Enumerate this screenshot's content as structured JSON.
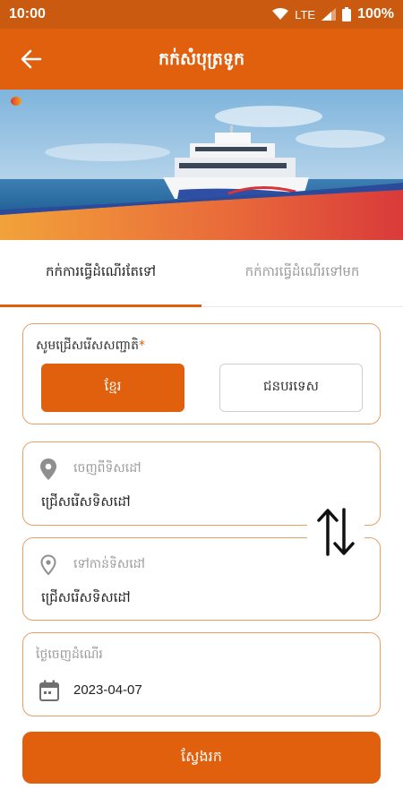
{
  "status_bar": {
    "time": "10:00",
    "network": "LTE",
    "battery": "100%",
    "icons": [
      "wifi-icon",
      "signal-icon",
      "battery-icon"
    ]
  },
  "app_bar": {
    "title": "កក់សំបុត្រទូក",
    "back_icon": "arrow-left-icon"
  },
  "tabs": [
    {
      "label": "កក់ការធ្វើដំណើរតែទៅ",
      "active": true
    },
    {
      "label": "កក់ការធ្វើដំណើរទៅមក",
      "active": false
    }
  ],
  "nationality": {
    "label": "សូមជ្រើសរើសសញ្ជាតិ",
    "required_mark": "*",
    "options": [
      {
        "label": "ខ្មែរ",
        "selected": true
      },
      {
        "label": "ជនបរទេស",
        "selected": false
      }
    ]
  },
  "from": {
    "label": "ចេញពីទិសដៅ",
    "value": "ជ្រើសរើសទិសដៅ",
    "icon": "location-pin-icon"
  },
  "to": {
    "label": "ទៅកាន់ទិសដៅ",
    "value": "ជ្រើសរើសទិសដៅ",
    "icon": "location-pin-outline-icon"
  },
  "swap": {
    "icon": "swap-vertical-icon"
  },
  "departure": {
    "label": "ថ្ងៃចេញដំណើរ",
    "date": "2023-04-07",
    "icon": "calendar-icon"
  },
  "search_button": {
    "label": "ស្វែងរក"
  },
  "colors": {
    "primary": "#e0600d",
    "status_bar": "#c95a0f",
    "card_border": "#e6a066"
  }
}
